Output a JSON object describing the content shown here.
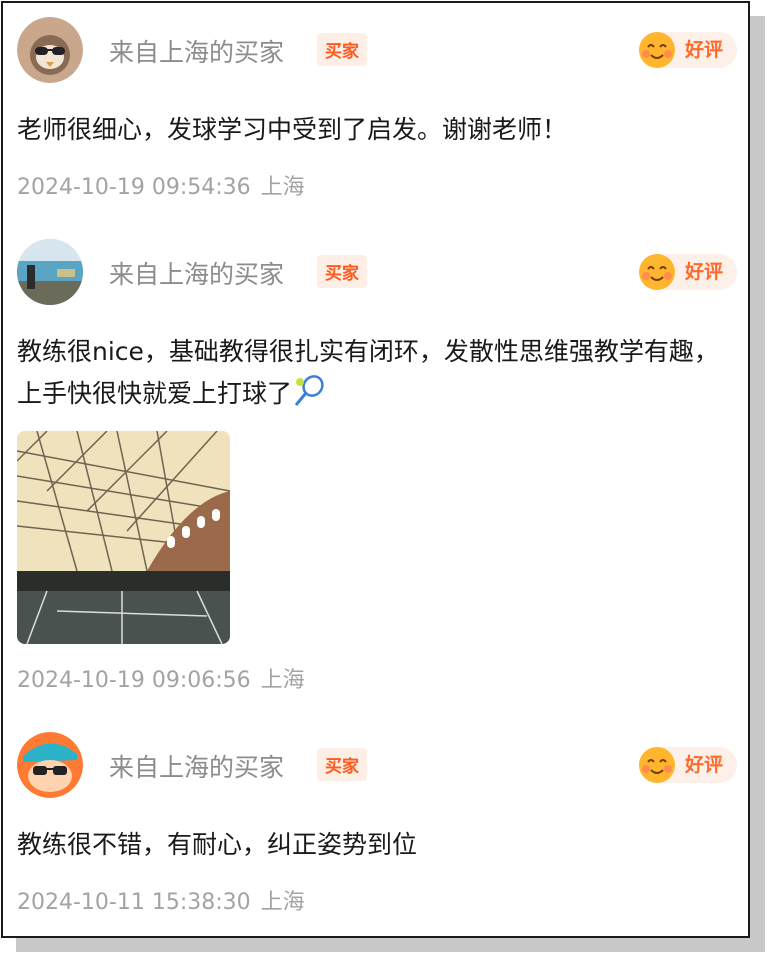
{
  "reviews": [
    {
      "user": "来自上海的买家",
      "badge": "买家",
      "rating": "好评",
      "text": "老师很细心，发球学习中受到了启发。谢谢老师！",
      "datetime": "2024-10-19 09:54:36",
      "location": "上海"
    },
    {
      "user": "来自上海的买家",
      "badge": "买家",
      "rating": "好评",
      "text": "教练很nice，基础教得很扎实有闭环，发散性思维强教学有趣，上手快很快就爱上打球了",
      "datetime": "2024-10-19 09:06:56",
      "location": "上海"
    },
    {
      "user": "来自上海的买家",
      "badge": "买家",
      "rating": "好评",
      "text": "教练很不错，有耐心，纠正姿势到位",
      "datetime": "2024-10-11 15:38:30",
      "location": "上海"
    }
  ],
  "colors": {
    "accent": "#ff5a1f",
    "muted": "#8c8c8c",
    "text": "#1a1a1a"
  },
  "icons": [
    "owl-avatar-icon",
    "pool-photo-avatar-icon",
    "cartoon-sunglasses-avatar-icon",
    "smiling-face-icon",
    "tennis-racket-icon"
  ]
}
